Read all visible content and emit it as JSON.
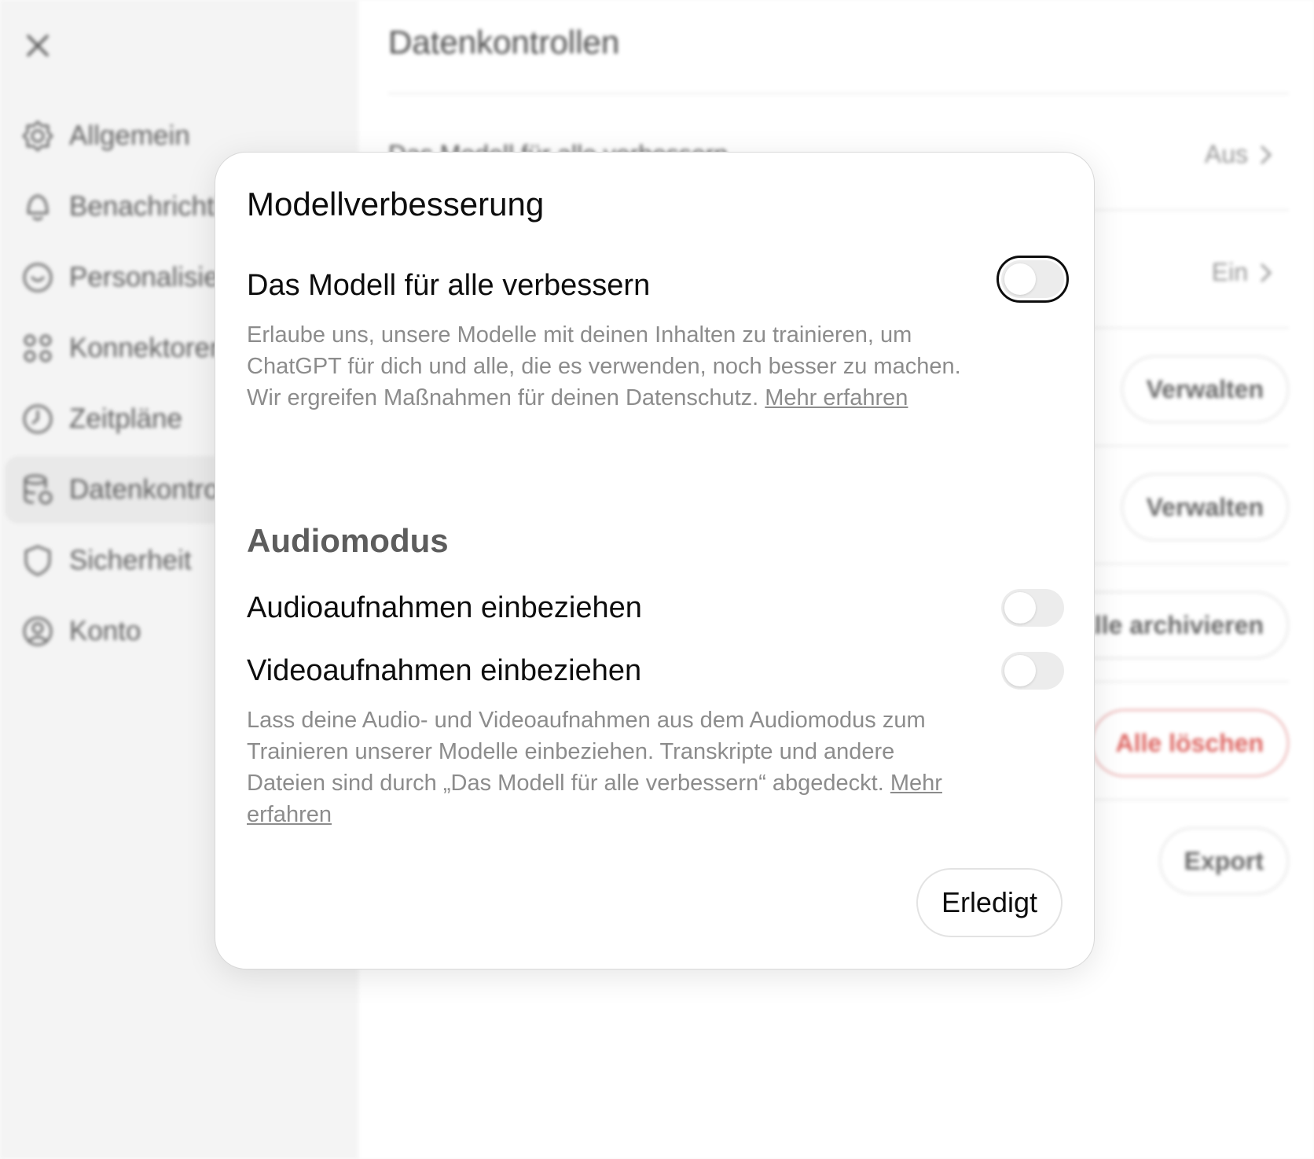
{
  "background": {
    "sidebar": {
      "items": [
        {
          "label": "Allgemein",
          "icon": "gear-icon"
        },
        {
          "label": "Benachrichtigungen",
          "icon": "bell-icon"
        },
        {
          "label": "Personalisierung",
          "icon": "personalization-icon"
        },
        {
          "label": "Konnektoren",
          "icon": "connectors-icon"
        },
        {
          "label": "Zeitpläne",
          "icon": "clock-icon"
        },
        {
          "label": "Datenkontrollen",
          "icon": "database-gear-icon",
          "active": true
        },
        {
          "label": "Sicherheit",
          "icon": "shield-icon"
        },
        {
          "label": "Konto",
          "icon": "user-circle-icon"
        }
      ]
    },
    "content": {
      "title": "Datenkontrollen",
      "rows": [
        {
          "label": "Das Modell für alle verbessern",
          "value": "Aus"
        },
        {
          "label": "",
          "value": "Ein"
        },
        {
          "button": "Verwalten"
        },
        {
          "button": "Verwalten"
        },
        {
          "button": "Alle archivieren"
        },
        {
          "button": "Alle löschen"
        },
        {
          "button": "Export"
        }
      ]
    }
  },
  "modal": {
    "title": "Modellverbesserung",
    "improve": {
      "title": "Das Modell für alle verbessern",
      "description": "Erlaube uns, unsere Modelle mit deinen Inhalten zu trainieren, um ChatGPT für dich und alle, die es verwenden, noch besser zu machen. Wir ergreifen Maßnahmen für deinen Datenschutz.",
      "link": "Mehr erfahren",
      "enabled": false
    },
    "audio_section": {
      "title": "Audiomodus",
      "audio": {
        "title": "Audioaufnahmen einbeziehen",
        "enabled": false
      },
      "video": {
        "title": "Videoaufnahmen einbeziehen",
        "enabled": false
      },
      "description": "Lass deine Audio- und Videoaufnahmen aus dem Audiomodus zum Trainieren unserer Modelle einbeziehen. Transkripte und andere Dateien sind durch „Das Modell für alle verbessern“ abgedeckt.",
      "link": "Mehr erfahren"
    },
    "done_label": "Erledigt"
  },
  "colors": {
    "accent_text": "#0d0d0d",
    "muted_text": "#8c8c8c",
    "danger": "#d9534f",
    "toggle_off": "#ececec"
  }
}
